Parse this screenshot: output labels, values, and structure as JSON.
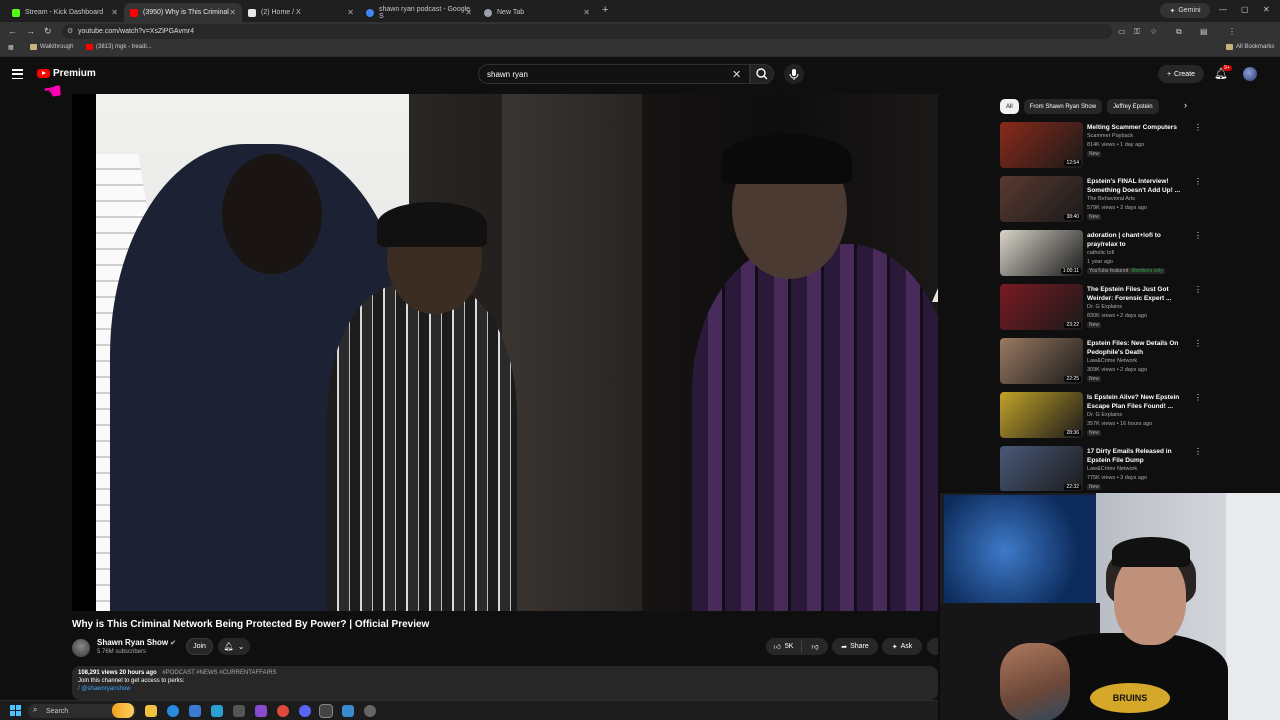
{
  "browser": {
    "tabs": [
      {
        "label": "Stream - Kick Dashboard",
        "color": "#53fc18"
      },
      {
        "label": "(3950) Why is This Criminal",
        "color": "#ff0000"
      },
      {
        "label": "(2) Home / X",
        "color": "#e7e7e7"
      },
      {
        "label": "shawn ryan podcast - Google S",
        "color": "#4285f4"
      },
      {
        "label": "New Tab",
        "color": "#9aa0a6"
      }
    ],
    "gemini_label": "Gemini",
    "url": "youtube.com/watch?v=XsZiPGAvmr4",
    "bookmarks": [
      {
        "label": "Walkthrough"
      },
      {
        "label": "(3813) mgk - treadi..."
      }
    ],
    "all_bookmarks": "All Bookmarks"
  },
  "youtube": {
    "logo_text": "Premium",
    "search_value": "shawn ryan",
    "create_label": "Create",
    "notification_count": "9+"
  },
  "video": {
    "title": "Why is This Criminal Network Being Protected By Power? | Official Preview",
    "channel": "Shawn Ryan Show",
    "subscribers": "5.76M subscribers",
    "join_label": "Join",
    "likes": "5K",
    "share_label": "Share",
    "ask_label": "Ask",
    "description": {
      "stats": "108,291 views  20 hours ago",
      "tags": "#PODCAST #NEWS #CURRENTAFFAIRS",
      "line": "Join this channel to get access to perks:",
      "handle": "/ @shawnryanshow"
    }
  },
  "sidebar": {
    "chips": [
      "All",
      "From Shawn Ryan Show",
      "Jeffrey Epstein"
    ],
    "recommendations": [
      {
        "title": "Melting Scammer Computers",
        "channel": "Scammer Payback",
        "meta": "814K views • 1 day ago",
        "badge": "New",
        "duration": "12:54",
        "thumb": "#8a2a1a"
      },
      {
        "title": "Epstein's FINAL Interview! Something Doesn't Add Up! ...",
        "channel": "The Behavioral Arts",
        "meta": "579K views • 2 days ago",
        "badge": "New",
        "duration": "38:40",
        "thumb": "#5a3a30"
      },
      {
        "title": "adoration | chant+lofi to pray/relax to",
        "channel": "catholic lofi",
        "meta": "1 year ago",
        "badge": "YouTube featured",
        "members": "Members only",
        "duration": "1:00:11",
        "thumb": "#d8d4c8"
      },
      {
        "title": "The Epstein Files Just Got Weirder: Forensic Expert ...",
        "channel": "Dr. G Explains",
        "meta": "830K views • 2 days ago",
        "badge": "New",
        "duration": "23:22",
        "thumb": "#7a1a22"
      },
      {
        "title": "Epstein Files: New Details On Pedophile's Death",
        "channel": "Law&Crime Network",
        "meta": "309K views • 2 days ago",
        "badge": "New",
        "duration": "22:25",
        "thumb": "#9a7a62"
      },
      {
        "title": "Is Epstein Alive? New Epstein Escape Plan Files Found! ...",
        "channel": "Dr. G Explains",
        "meta": "357K views • 16 hours ago",
        "badge": "New",
        "duration": "28:36",
        "thumb": "#c2a22a"
      },
      {
        "title": "17 Dirty Emails Released in Epstein File Dump",
        "channel": "Law&Crime Network",
        "meta": "775K views • 3 days ago",
        "badge": "New",
        "duration": "22:32",
        "thumb": "#4a5a7a"
      }
    ]
  },
  "webcam": {
    "shirt_text": "BRUINS"
  },
  "taskbar": {
    "search_label": "Search"
  }
}
